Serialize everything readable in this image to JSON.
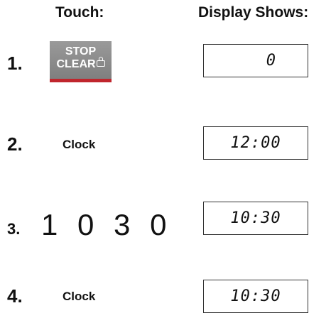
{
  "headers": {
    "touch": "Touch:",
    "display": "Display Shows:"
  },
  "steps": [
    {
      "number": "1.",
      "key_label_line1": "STOP",
      "key_label_line2": "CLEAR",
      "display": "0"
    },
    {
      "number": "2.",
      "key": "Clock",
      "display": "12:00"
    },
    {
      "number": "3.",
      "key": "1 0 3 0",
      "display": "10:30"
    },
    {
      "number": "4.",
      "key": "Clock",
      "display": "10:30"
    }
  ],
  "colors": {
    "stop_clear_button": "#8c8c8c",
    "stop_clear_accent": "#c0262d"
  },
  "icons": {
    "stop_clear": "lock-icon"
  }
}
